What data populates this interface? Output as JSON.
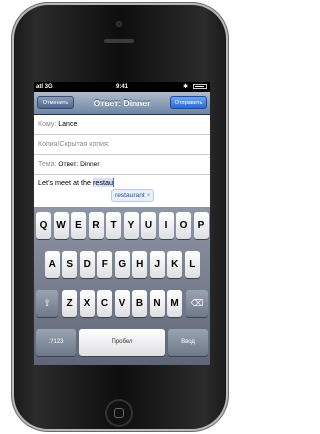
{
  "status_bar": {
    "signal": "atl 3G",
    "time": "9:41",
    "bluetooth": "✱"
  },
  "nav": {
    "cancel_label": "Отменить",
    "title": "Ответ: Dinner",
    "send_label": "Отправить"
  },
  "fields": {
    "to": {
      "label": "Кому:",
      "value": "Lance"
    },
    "cc": {
      "label": "Копия/Скрытая копия:",
      "value": ""
    },
    "subject": {
      "label": "Тема:",
      "value": "Ответ: Dinner"
    }
  },
  "body": {
    "text_before": "Let’s meet at the ",
    "typed_word": "restau"
  },
  "autocorrect": {
    "suggestion": "restaurant",
    "dismiss": "×"
  },
  "keyboard": {
    "row1": [
      "Q",
      "W",
      "E",
      "R",
      "T",
      "Y",
      "U",
      "I",
      "O",
      "P"
    ],
    "row2": [
      "A",
      "S",
      "D",
      "F",
      "G",
      "H",
      "J",
      "K",
      "L"
    ],
    "row3": [
      "Z",
      "X",
      "C",
      "V",
      "B",
      "N",
      "M"
    ],
    "shift": "⇧",
    "backspace": "⌫",
    "numbers": ".?123",
    "space": "Пробел",
    "return": "Ввод"
  }
}
